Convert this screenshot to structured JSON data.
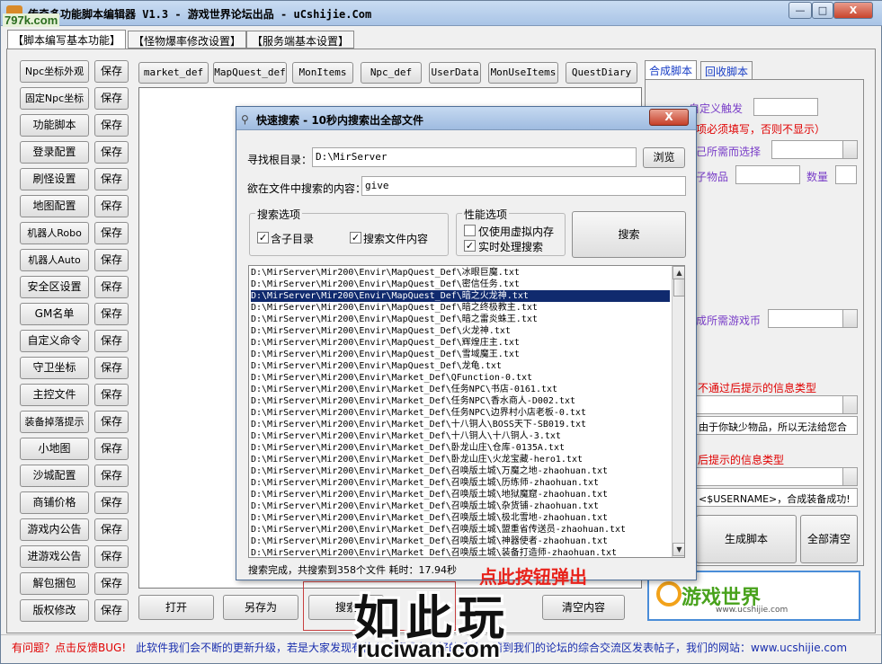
{
  "window": {
    "title": "传奇多功能脚本编辑器 V1.3 - 游戏世界论坛出品 - uCshijie.Com",
    "site_watermark": "797k.com",
    "controls": {
      "minimize": "—",
      "maximize": "□",
      "close": "X"
    }
  },
  "tabs": [
    "【脚本编写基本功能】",
    "【怪物爆率修改设置】",
    "【服务端基本设置】"
  ],
  "left_panel": {
    "items": [
      "Npc坐标外观",
      "固定Npc坐标",
      "功能脚本",
      "登录配置",
      "刷怪设置",
      "地图配置",
      "机器人Robo",
      "机器人Auto",
      "安全区设置",
      "GM名单",
      "自定义命令",
      "守卫坐标",
      "主控文件",
      "装备掉落提示",
      "小地图",
      "沙城配置",
      "商铺价格",
      "游戏内公告",
      "进游戏公告",
      "解包捆包",
      "版权修改"
    ],
    "save_label": "保存"
  },
  "top_buttons": [
    "market_def",
    "MapQuest_def",
    "MonItems",
    "Npc_def",
    "UserData",
    "MonUseItems",
    "QuestDiary"
  ],
  "bottom_buttons": {
    "open": "打开",
    "save_as": "另存为",
    "search": "搜索",
    "clear": "清空内容"
  },
  "right_panel": {
    "tabs": [
      "合成脚本",
      "回收脚本"
    ],
    "custom_trigger": "自定义触发",
    "required_note": "项必须填写，否则不显示）",
    "select_needed": "己所需而选择",
    "item_label": "子物品",
    "quantity_label": "数量",
    "gold_needed": "成所需游戏币",
    "fail_type": "不通过后提示的信息类型",
    "fail_msg": "由于你缺少物品，所以无法给您合",
    "success_type": "后提示的信息类型",
    "success_msg": "<$USERNAME>，合成装备成功!",
    "gen_button": "生成脚本",
    "clear_button": "全部清空",
    "logo_text": "游戏世界",
    "logo_url": "www.ucshijie.com"
  },
  "status": {
    "feedback": "有问题？点击反馈BUG!",
    "message": "此软件我们会不断的更新升级，若是大家发现有什么问题或者有好的建议，请到我们的论坛的综合交流区发表帖子，我们的网站：www.ucshijie.com"
  },
  "dialog": {
    "title": "快速搜索 - 10秒内搜索出全部文件",
    "close_label": "X",
    "root_label": "寻找根目录：",
    "root_value": "D:\\MirServer",
    "browse": "浏览",
    "content_label": "欲在文件中搜索的内容：",
    "content_value": "give",
    "search_options_title": "搜索选项",
    "opt_subdirs": "含子目录",
    "opt_content": "搜索文件内容",
    "perf_title": "性能选项",
    "opt_virtual": "仅使用虚拟内存",
    "opt_realtime": "实时处理搜索",
    "search_button": "搜索",
    "results": [
      "D:\\MirServer\\Mir200\\Envir\\MapQuest_Def\\冰眼巨魔.txt",
      "D:\\MirServer\\Mir200\\Envir\\MapQuest_Def\\密信任务.txt",
      "D:\\MirServer\\Mir200\\Envir\\MapQuest_Def\\暗之火龙神.txt",
      "D:\\MirServer\\Mir200\\Envir\\MapQuest_Def\\暗之终极教主.txt",
      "D:\\MirServer\\Mir200\\Envir\\MapQuest_Def\\暗之雷炎蛛王.txt",
      "D:\\MirServer\\Mir200\\Envir\\MapQuest_Def\\火龙神.txt",
      "D:\\MirServer\\Mir200\\Envir\\MapQuest_Def\\辉煌庄主.txt",
      "D:\\MirServer\\Mir200\\Envir\\MapQuest_Def\\雪域魔王.txt",
      "D:\\MirServer\\Mir200\\Envir\\MapQuest_Def\\龙龟.txt",
      "D:\\MirServer\\Mir200\\Envir\\Market_Def\\QFunction-0.txt",
      "D:\\MirServer\\Mir200\\Envir\\Market_Def\\任务NPC\\书店-0161.txt",
      "D:\\MirServer\\Mir200\\Envir\\Market_Def\\任务NPC\\香水商人-D002.txt",
      "D:\\MirServer\\Mir200\\Envir\\Market_Def\\任务NPC\\边界村小店老板-0.txt",
      "D:\\MirServer\\Mir200\\Envir\\Market_Def\\十八铜人\\BOSS天下-SB019.txt",
      "D:\\MirServer\\Mir200\\Envir\\Market_Def\\十八铜人\\十八铜人-3.txt",
      "D:\\MirServer\\Mir200\\Envir\\Market_Def\\卧龙山庄\\仓库-0135A.txt",
      "D:\\MirServer\\Mir200\\Envir\\Market_Def\\卧龙山庄\\火龙宝藏-hero1.txt",
      "D:\\MirServer\\Mir200\\Envir\\Market_Def\\召唤版土城\\万魔之地-zhaohuan.txt",
      "D:\\MirServer\\Mir200\\Envir\\Market_Def\\召唤版土城\\历练师-zhaohuan.txt",
      "D:\\MirServer\\Mir200\\Envir\\Market_Def\\召唤版土城\\地狱魔窟-zhaohuan.txt",
      "D:\\MirServer\\Mir200\\Envir\\Market_Def\\召唤版土城\\杂货铺-zhaohuan.txt",
      "D:\\MirServer\\Mir200\\Envir\\Market_Def\\召唤版土城\\极北雪地-zhaohuan.txt",
      "D:\\MirServer\\Mir200\\Envir\\Market_Def\\召唤版土城\\盟重省传送员-zhaohuan.txt",
      "D:\\MirServer\\Mir200\\Envir\\Market_Def\\召唤版土城\\神器使者-zhaohuan.txt",
      "D:\\MirServer\\Mir200\\Envir\\Market_Def\\召唤版土城\\装备打造师-zhaohuan.txt"
    ],
    "selected_index": 2,
    "status": "搜索完成，共搜索到358个文件   耗时：17.94秒"
  },
  "overlay": {
    "hint": "点此按钮弹出",
    "watermark": "如此玩",
    "watermark_url": "ruciwan.com"
  }
}
